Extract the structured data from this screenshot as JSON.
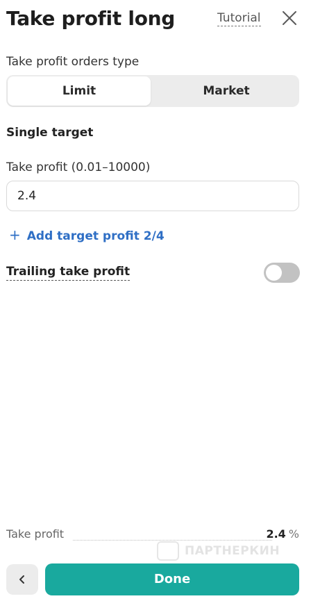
{
  "header": {
    "title": "Take profit long",
    "tutorial_label": "Tutorial",
    "close_icon": "close-icon"
  },
  "order_type": {
    "label": "Take profit orders type",
    "options": [
      "Limit",
      "Market"
    ],
    "selected": "Limit"
  },
  "single_target": {
    "title": "Single target",
    "take_profit_label": "Take profit (0.01–10000)",
    "take_profit_value": "2.4",
    "add_target_icon": "plus-icon",
    "add_target_label": "Add target profit 2/4"
  },
  "trailing": {
    "label": "Trailing take profit",
    "enabled": false
  },
  "summary": {
    "label": "Take profit",
    "value": "2.4",
    "unit": "%"
  },
  "watermark": {
    "text": "ПАРТНЕРКИН"
  },
  "footer": {
    "back_icon": "chevron-left-icon",
    "done_label": "Done"
  },
  "colors": {
    "accent": "#19a99e",
    "link": "#2f6fc5",
    "toggle_off": "#c2c2c2",
    "segment_bg": "#ececec"
  }
}
